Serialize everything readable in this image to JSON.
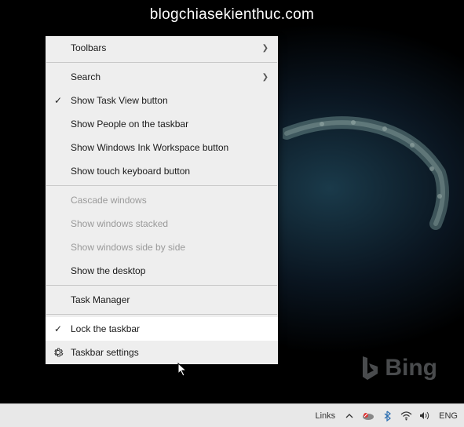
{
  "watermark": "blogchiasekienthuc.com",
  "branding": {
    "name": "Bing"
  },
  "menu": {
    "toolbars": "Toolbars",
    "search": "Search",
    "showTaskView": "Show Task View button",
    "showPeople": "Show People on the taskbar",
    "showInk": "Show Windows Ink Workspace button",
    "showTouch": "Show touch keyboard button",
    "cascade": "Cascade windows",
    "stacked": "Show windows stacked",
    "sideBySide": "Show windows side by side",
    "showDesktop": "Show the desktop",
    "taskManager": "Task Manager",
    "lockTaskbar": "Lock the taskbar",
    "taskbarSettings": "Taskbar settings",
    "checked": {
      "showTaskView": true,
      "lockTaskbar": true
    },
    "hovered": "lockTaskbar"
  },
  "taskbar": {
    "links": "Links",
    "lang": "ENG"
  }
}
